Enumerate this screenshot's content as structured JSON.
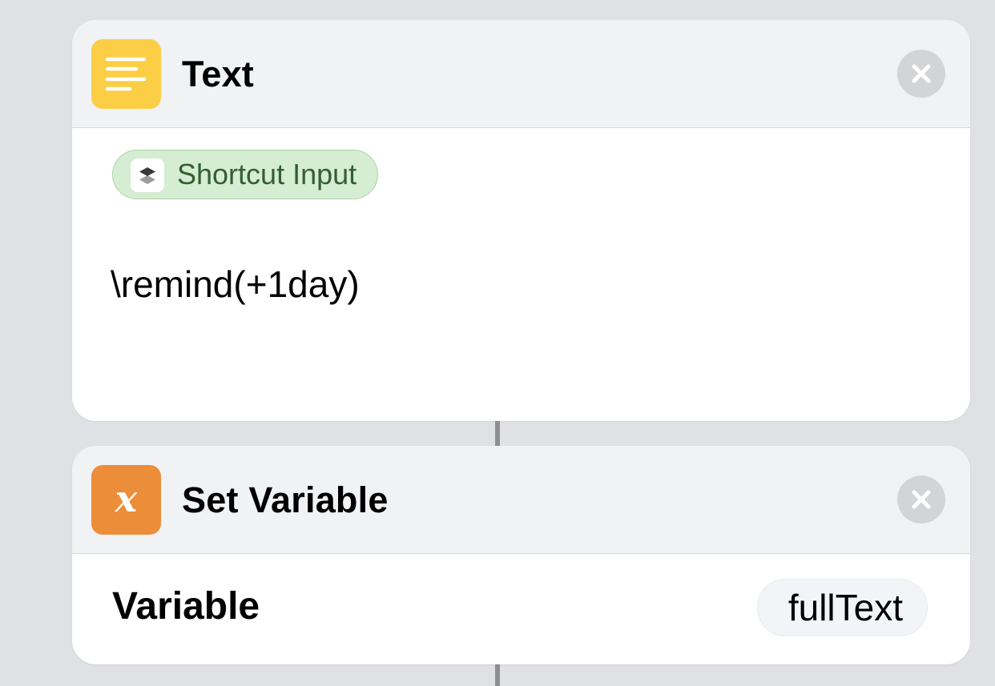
{
  "colors": {
    "background": "#e0e1e5",
    "card": "#ffffff",
    "header": "#f1f2f4",
    "text_action_icon": "#fbce45",
    "set_variable_icon": "#ec8d3a",
    "token_fill": "#d5edd2",
    "token_text": "#335f33"
  },
  "actions": [
    {
      "title": "Text",
      "icon": "text-lines-icon",
      "token": {
        "label": "Shortcut Input",
        "icon": "shortcuts-layers-icon"
      },
      "content": "\\remind(+1day)"
    },
    {
      "title": "Set Variable",
      "icon": "variable-x-icon",
      "icon_glyph": "x",
      "parameter": {
        "label": "Variable",
        "value": "fullText"
      }
    }
  ]
}
